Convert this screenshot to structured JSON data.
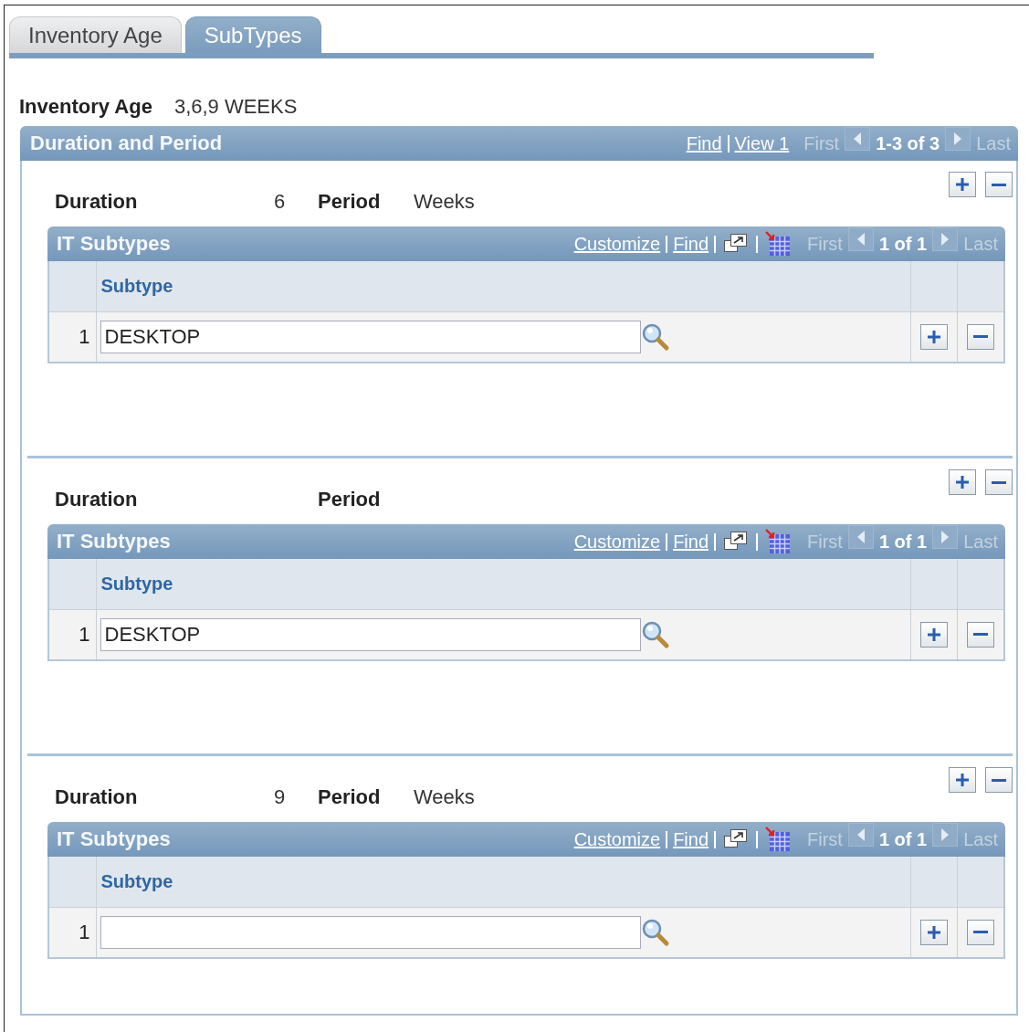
{
  "tabs": [
    {
      "label": "Inventory Age",
      "selected": false
    },
    {
      "label": "SubTypes",
      "selected": true
    }
  ],
  "header": {
    "label": "Inventory Age",
    "value": "3,6,9 WEEKS"
  },
  "grid": {
    "title": "Duration and Period",
    "links": [
      "Find",
      "View 1"
    ],
    "nav": {
      "first": {
        "label": "First",
        "disabled": true
      },
      "range": "1-3 of 3",
      "last": {
        "label": "Last",
        "disabled": true
      }
    },
    "rows": [
      {
        "duration_label": "Duration",
        "duration": "6",
        "period_label": "Period",
        "period": "Weeks",
        "subgrid": {
          "title": "IT Subtypes",
          "links": [
            "Customize",
            "Find"
          ],
          "nav": {
            "first": {
              "label": "First",
              "disabled": true
            },
            "range": "1 of 1",
            "last": {
              "label": "Last",
              "disabled": true
            }
          },
          "column": "Subtype",
          "rows": [
            {
              "number": "1",
              "value": "DESKTOP"
            }
          ]
        }
      },
      {
        "duration_label": "Duration",
        "period_label": "Period",
        "subgrid": {
          "title": "IT Subtypes",
          "links": [
            "Customize",
            "Find"
          ],
          "nav": {
            "first": {
              "label": "First",
              "disabled": true
            },
            "range": "1 of 1",
            "last": {
              "label": "Last",
              "disabled": true
            }
          },
          "column": "Subtype",
          "rows": [
            {
              "number": "1",
              "value": "DESKTOP"
            }
          ]
        }
      },
      {
        "duration_label": "Duration",
        "duration": "9",
        "period_label": "Period",
        "period": "Weeks",
        "subgrid": {
          "title": "IT Subtypes",
          "links": [
            "Customize",
            "Find"
          ],
          "nav": {
            "first": {
              "label": "First",
              "disabled": true
            },
            "range": "1 of 1",
            "last": {
              "label": "Last",
              "disabled": true
            }
          },
          "column": "Subtype",
          "rows": [
            {
              "number": "1",
              "value": ""
            }
          ]
        }
      }
    ]
  }
}
